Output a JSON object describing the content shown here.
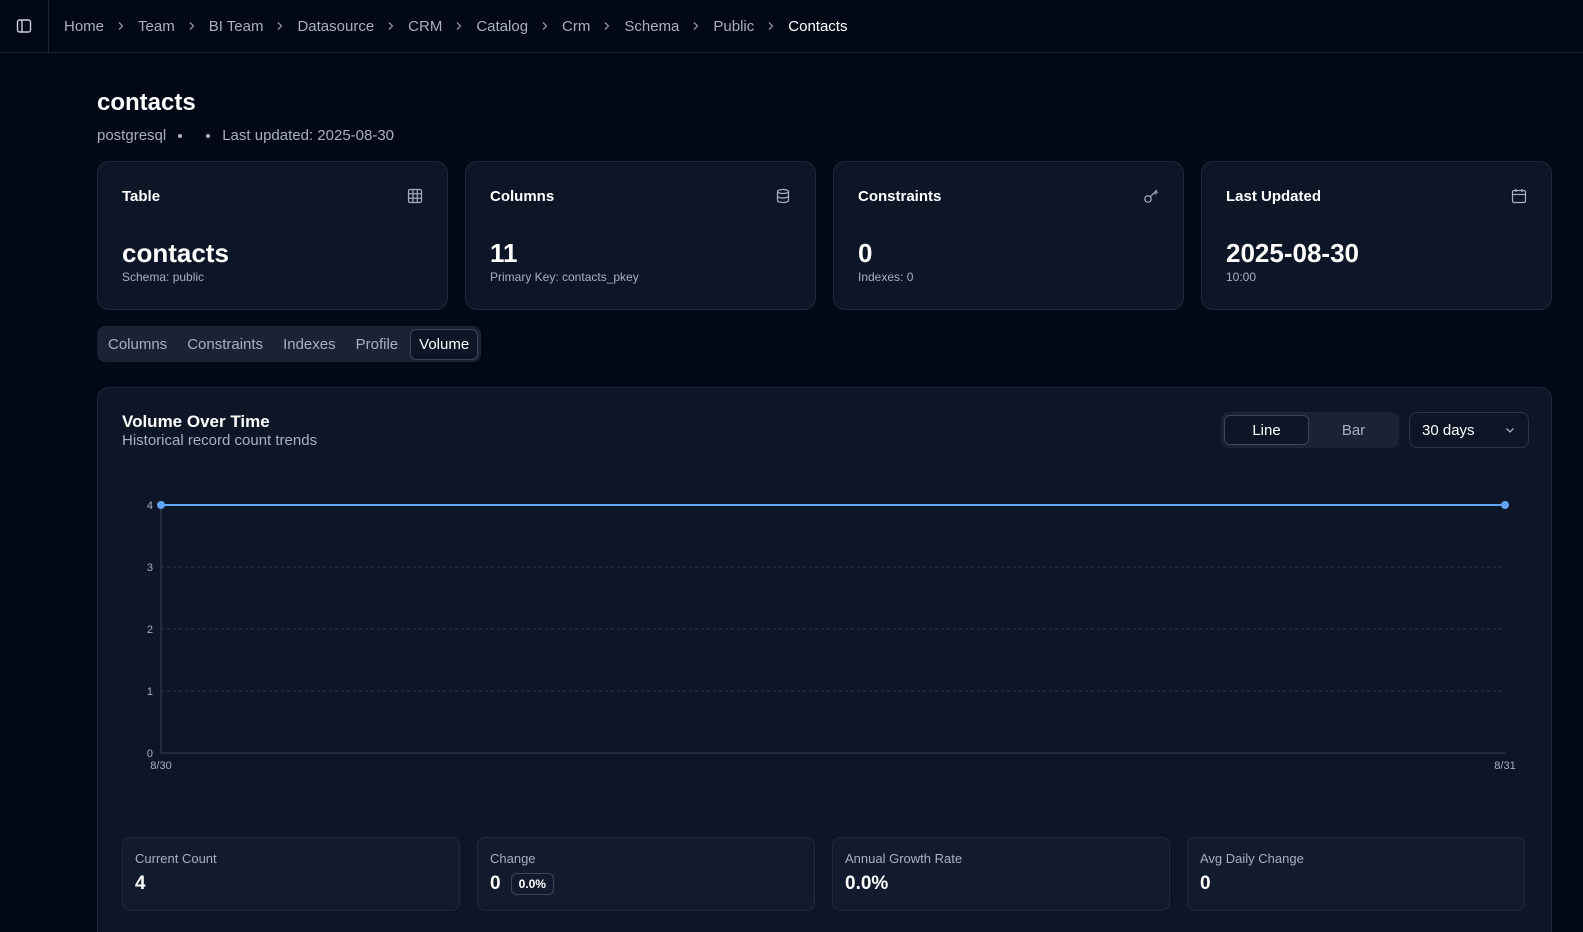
{
  "breadcrumb": [
    "Home",
    "Team",
    "BI Team",
    "Datasource",
    "CRM",
    "Catalog",
    "Crm",
    "Schema",
    "Public",
    "Contacts"
  ],
  "page": {
    "title": "contacts",
    "engine": "postgresql",
    "last_updated": "Last updated: 2025-08-30"
  },
  "cards": [
    {
      "label": "Table",
      "value": "contacts",
      "sub": "Schema: public",
      "icon": "table-icon"
    },
    {
      "label": "Columns",
      "value": "11",
      "sub": "Primary Key: contacts_pkey",
      "icon": "database-icon"
    },
    {
      "label": "Constraints",
      "value": "0",
      "sub": "Indexes: 0",
      "icon": "key-icon"
    },
    {
      "label": "Last Updated",
      "value": "2025-08-30",
      "sub": "10:00",
      "icon": "calendar-icon"
    }
  ],
  "tabs": [
    "Columns",
    "Constraints",
    "Indexes",
    "Profile",
    "Volume"
  ],
  "active_tab": "Volume",
  "panel": {
    "title": "Volume Over Time",
    "subtitle": "Historical record count trends",
    "view_line": "Line",
    "view_bar": "Bar",
    "active_view": "Line",
    "range": "30 days"
  },
  "chart_data": {
    "type": "line",
    "x": [
      "8/30",
      "8/31"
    ],
    "series": [
      {
        "values": [
          4,
          4
        ]
      }
    ],
    "yticks": [
      "0",
      "1",
      "2",
      "3",
      "4"
    ],
    "ylim": [
      0,
      4
    ],
    "grid": true,
    "color": "#60a5fa"
  },
  "stats": [
    {
      "label": "Current Count",
      "value": "4"
    },
    {
      "label": "Change",
      "value": "0",
      "badge": "0.0%"
    },
    {
      "label": "Annual Growth Rate",
      "value": "0.0%"
    },
    {
      "label": "Avg Daily Change",
      "value": "0"
    }
  ],
  "colors": {
    "background": "#030816",
    "card": "#0d1627",
    "accent": "#60a5fa"
  }
}
